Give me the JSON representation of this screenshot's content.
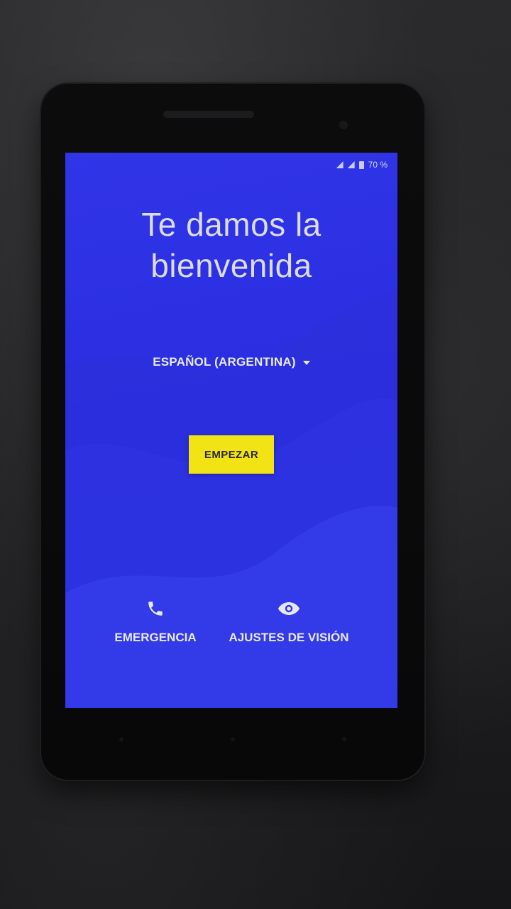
{
  "status_bar": {
    "battery_text": "70 %"
  },
  "welcome": {
    "title_line1": "Te damos la",
    "title_line2": "bienvenida"
  },
  "language": {
    "selected": "ESPAÑOL (ARGENTINA)"
  },
  "start_button": {
    "label": "EMPEZAR"
  },
  "emergency": {
    "label": "EMERGENCIA",
    "icon": "phone-icon"
  },
  "vision": {
    "label": "AJUSTES DE VISIÓN",
    "icon": "eye-icon"
  },
  "colors": {
    "screen_background": "#2f33e6",
    "button_background": "#f2e414",
    "text": "#e8e8f4"
  }
}
